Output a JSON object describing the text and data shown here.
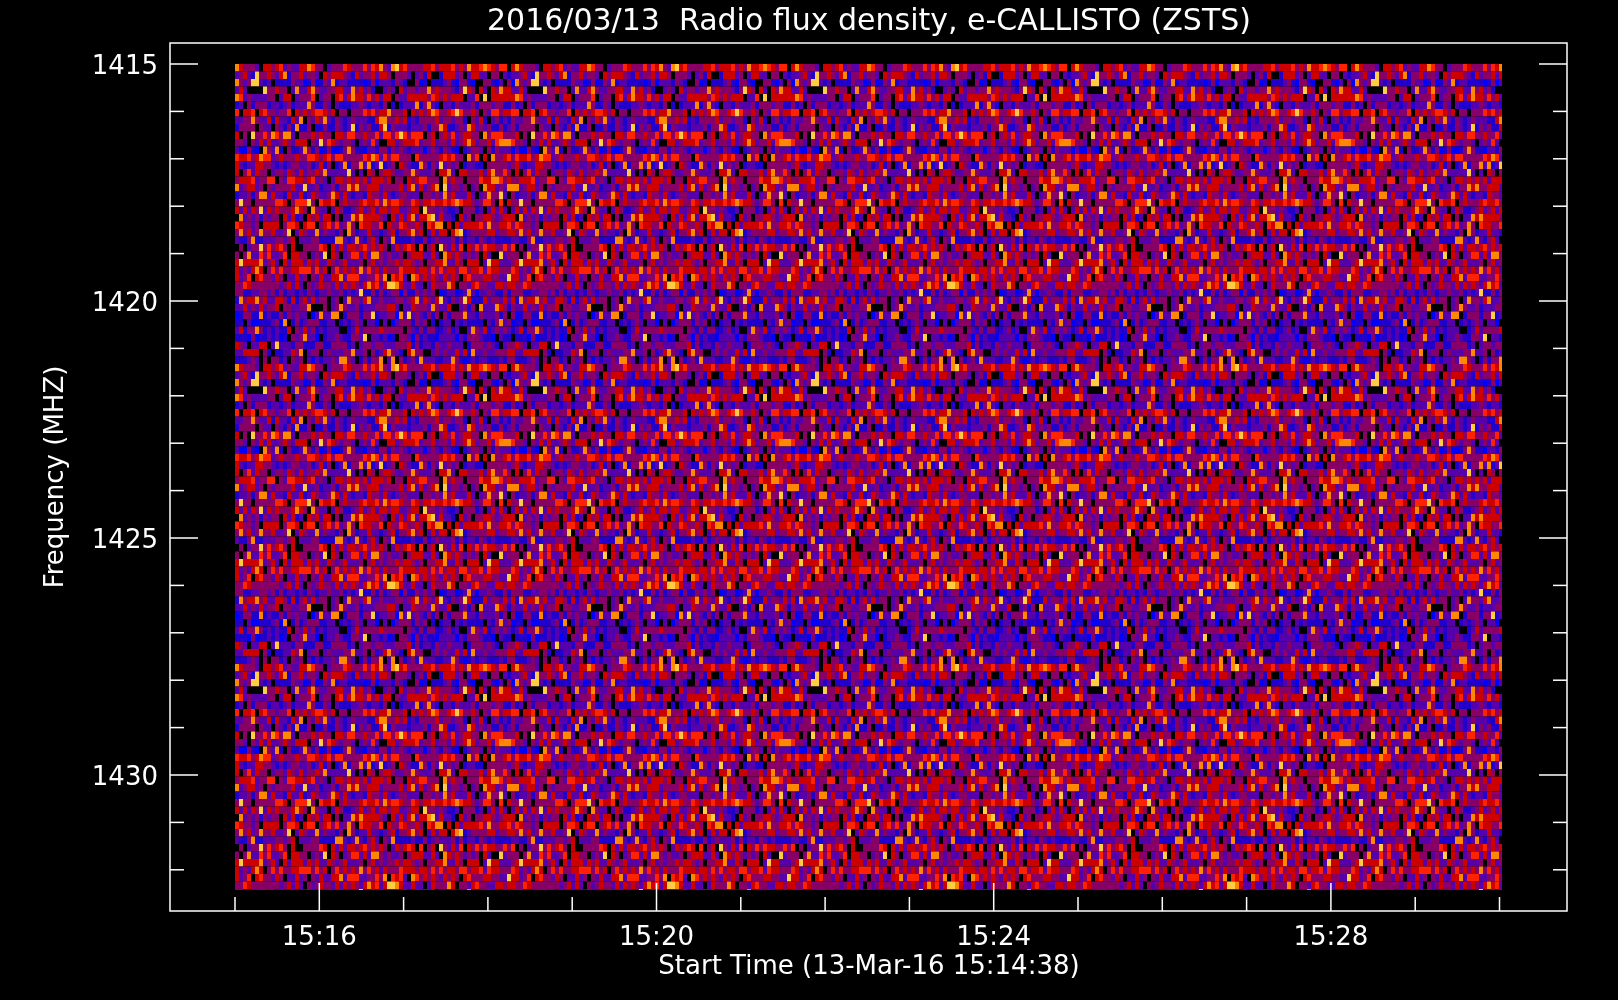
{
  "title": "2016/03/13  Radio flux density, e-CALLISTO (ZSTS)",
  "y_axis": {
    "label": "Frequency (MHZ)",
    "ticks": [
      "1415",
      "1420",
      "1425",
      "1430"
    ]
  },
  "x_axis": {
    "label": "Start Time (13-Mar-16 15:14:38)",
    "ticks": [
      "15:16",
      "15:20",
      "15:24",
      "15:28"
    ]
  }
}
